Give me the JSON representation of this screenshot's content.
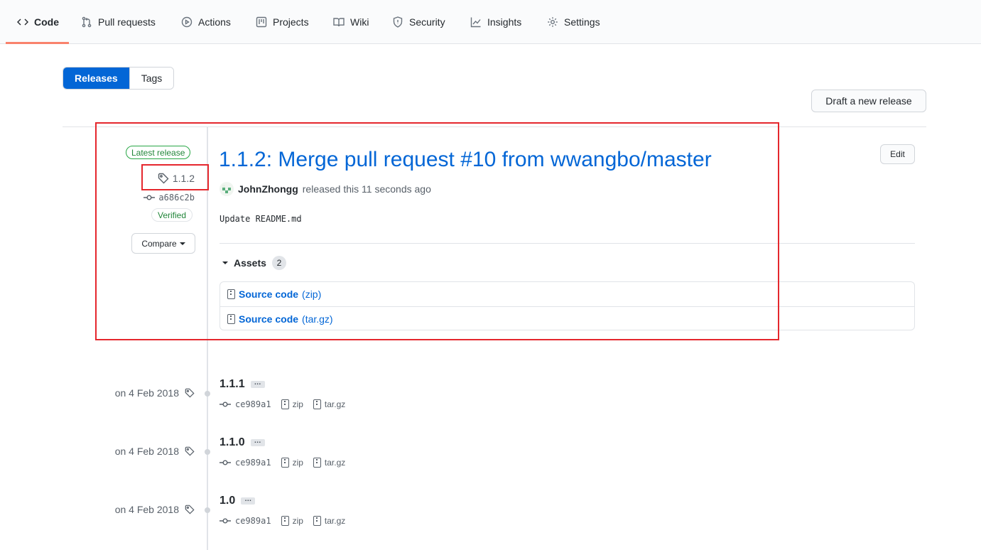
{
  "nav": {
    "tabs": [
      {
        "label": "Code",
        "icon": "code-icon"
      },
      {
        "label": "Pull requests",
        "icon": "pull-request-icon"
      },
      {
        "label": "Actions",
        "icon": "play-icon"
      },
      {
        "label": "Projects",
        "icon": "project-icon"
      },
      {
        "label": "Wiki",
        "icon": "book-icon"
      },
      {
        "label": "Security",
        "icon": "shield-icon"
      },
      {
        "label": "Insights",
        "icon": "graph-icon"
      },
      {
        "label": "Settings",
        "icon": "gear-icon"
      }
    ],
    "active_tab": "Code"
  },
  "toggle": {
    "releases": "Releases",
    "tags": "Tags",
    "active": "Releases"
  },
  "draft_button": "Draft a new release",
  "latest": {
    "badge": "Latest release",
    "tag": "1.1.2",
    "commit": "a686c2b",
    "verified": "Verified",
    "compare": "Compare",
    "title": "1.1.2: Merge pull request #10 from wwangbo/master",
    "author": "JohnZhongg",
    "released_text": "released this 11 seconds ago",
    "edit": "Edit",
    "description": "Update README.md",
    "assets_label": "Assets",
    "assets_count": "2",
    "assets": [
      {
        "name": "Source code",
        "ext": "(zip)"
      },
      {
        "name": "Source code",
        "ext": "(tar.gz)"
      }
    ]
  },
  "older": [
    {
      "date": "on 4 Feb 2018",
      "tag": "1.1.1",
      "more": "…",
      "commit": "ce989a1",
      "zip": "zip",
      "targz": "tar.gz"
    },
    {
      "date": "on 4 Feb 2018",
      "tag": "1.1.0",
      "more": "…",
      "commit": "ce989a1",
      "zip": "zip",
      "targz": "tar.gz"
    },
    {
      "date": "on 4 Feb 2018",
      "tag": "1.0",
      "more": "…",
      "commit": "ce989a1",
      "zip": "zip",
      "targz": "tar.gz"
    }
  ],
  "colors": {
    "accent": "#0366d6",
    "tab_underline": "#f9826c",
    "verified": "#22863a",
    "annotation": "#e5272d"
  }
}
